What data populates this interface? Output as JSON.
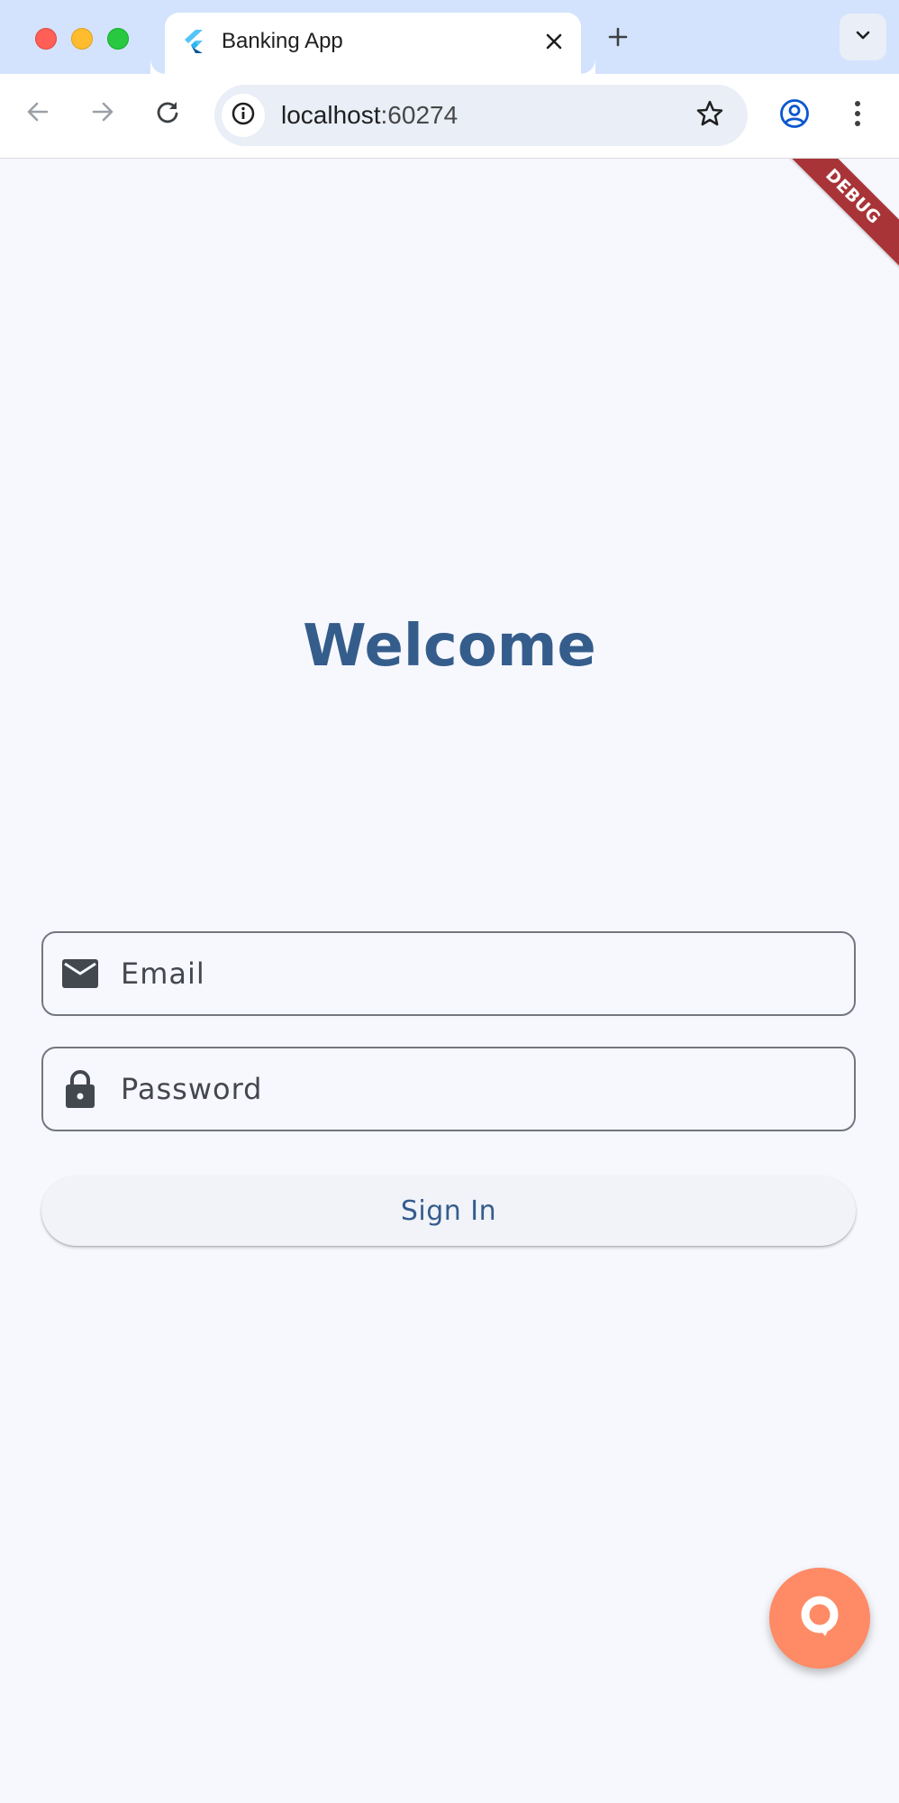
{
  "browser": {
    "tab_title": "Banking App",
    "url_host": "localhost",
    "url_port": ":60274",
    "icons": {
      "favicon": "flutter-logo-icon",
      "close": "close-icon",
      "new_tab": "plus-icon",
      "tab_search": "chevron-down-icon",
      "back": "arrow-left-icon",
      "forward": "arrow-right-icon",
      "reload": "reload-icon",
      "site_info": "info-icon",
      "bookmark": "star-icon",
      "profile": "account-circle-icon",
      "menu": "more-vertical-icon"
    }
  },
  "app": {
    "debug_banner": "DEBUG",
    "welcome_title": "Welcome",
    "email": {
      "placeholder": "Email",
      "value": "",
      "icon": "mail-icon"
    },
    "password": {
      "placeholder": "Password",
      "value": "",
      "icon": "lock-icon"
    },
    "sign_in_label": "Sign In",
    "fab_icon": "chat-bubble-icon",
    "colors": {
      "primary": "#355d8c",
      "background": "#f7f8fd",
      "fab": "#ff8a66",
      "debug": "#a83438"
    }
  }
}
